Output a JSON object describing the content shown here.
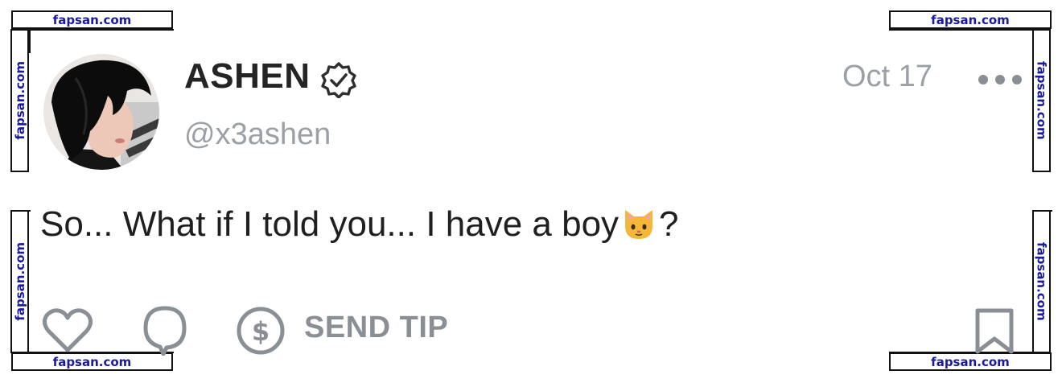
{
  "watermark": {
    "text": "fapsan.com"
  },
  "post": {
    "author_name": "ASHEN",
    "author_handle": "@x3ashen",
    "date": "Oct 17",
    "text_before_emoji": "So... What if I told you... I have a boy",
    "text_after_emoji": "?",
    "emoji": "cat-face"
  },
  "actions": {
    "send_tip_label": "SEND TIP"
  },
  "icons": [
    "verified-badge-icon",
    "more-options-icon",
    "heart-icon",
    "comment-icon",
    "dollar-icon",
    "bookmark-icon"
  ],
  "colors": {
    "text": "#1f1f1f",
    "muted": "#9ba0a6",
    "icon": "#8a8f96",
    "watermark": "#1a1aa0"
  }
}
